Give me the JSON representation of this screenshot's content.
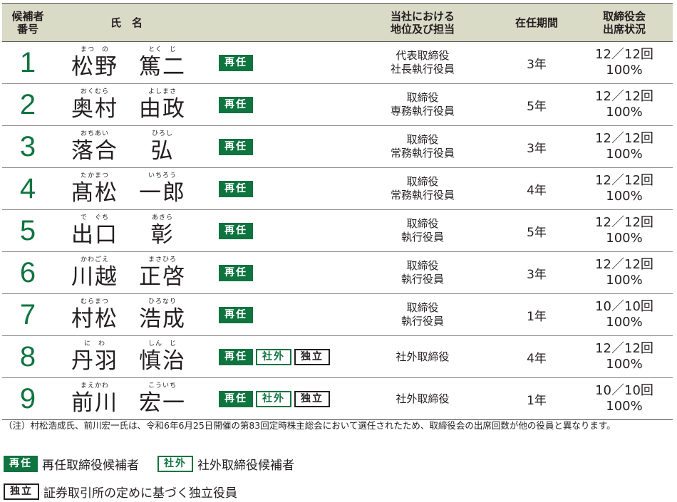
{
  "header": {
    "col_num": "候補者\n番号",
    "col_name": "氏　名",
    "col_position": "当社における\n地位及び担当",
    "col_term": "在任期間",
    "col_attendance": "取締役会\n出席状況"
  },
  "badges": {
    "reelection": "再任",
    "outside": "社外",
    "independent": "独立"
  },
  "candidates": [
    {
      "num": "1",
      "family": "松野",
      "family_ruby": "まつ　の",
      "given": "篤二",
      "given_ruby": "とく　じ",
      "position": "代表取締役\n社長執行役員",
      "term": "3年",
      "attendance": "12／12回",
      "rate": "100%",
      "outside": false,
      "independent": false
    },
    {
      "num": "2",
      "family": "奥村",
      "family_ruby": "おくむら",
      "given": "由政",
      "given_ruby": "よしまさ",
      "position": "取締役\n専務執行役員",
      "term": "5年",
      "attendance": "12／12回",
      "rate": "100%",
      "outside": false,
      "independent": false
    },
    {
      "num": "3",
      "family": "落合",
      "family_ruby": "おちあい",
      "given": "弘",
      "given_ruby": "ひろし",
      "position": "取締役\n常務執行役員",
      "term": "3年",
      "attendance": "12／12回",
      "rate": "100%",
      "outside": false,
      "independent": false
    },
    {
      "num": "4",
      "family": "髙松",
      "family_ruby": "たかまつ",
      "given": "一郎",
      "given_ruby": "いちろう",
      "position": "取締役\n常務執行役員",
      "term": "4年",
      "attendance": "12／12回",
      "rate": "100%",
      "outside": false,
      "independent": false
    },
    {
      "num": "5",
      "family": "出口",
      "family_ruby": "で　ぐち",
      "given": "彰",
      "given_ruby": "あきら",
      "position": "取締役\n執行役員",
      "term": "5年",
      "attendance": "12／12回",
      "rate": "100%",
      "outside": false,
      "independent": false
    },
    {
      "num": "6",
      "family": "川越",
      "family_ruby": "かわごえ",
      "given": "正啓",
      "given_ruby": "まさひろ",
      "position": "取締役\n執行役員",
      "term": "3年",
      "attendance": "12／12回",
      "rate": "100%",
      "outside": false,
      "independent": false
    },
    {
      "num": "7",
      "family": "村松",
      "family_ruby": "むらまつ",
      "given": "浩成",
      "given_ruby": "ひろなり",
      "position": "取締役\n執行役員",
      "term": "1年",
      "attendance": "10／10回",
      "rate": "100%",
      "outside": false,
      "independent": false
    },
    {
      "num": "8",
      "family": "丹羽",
      "family_ruby": "に　わ",
      "given": "慎治",
      "given_ruby": "しん　じ",
      "position": "社外取締役",
      "term": "4年",
      "attendance": "12／12回",
      "rate": "100%",
      "outside": true,
      "independent": true
    },
    {
      "num": "9",
      "family": "前川",
      "family_ruby": "まえかわ",
      "given": "宏一",
      "given_ruby": "こういち",
      "position": "社外取締役",
      "term": "1年",
      "attendance": "10／10回",
      "rate": "100%",
      "outside": true,
      "independent": true
    }
  ],
  "note": "（注）村松浩成氏、前川宏一氏は、令和6年6月25日開催の第83回定時株主総会において選任されたため、取締役会の出席回数が他の役員と異なります。",
  "legend": {
    "reelection_text": "再任取締役候補者",
    "outside_text": "社外取締役候補者",
    "independent_text": "証券取引所の定めに基づく独立役員"
  },
  "colors": {
    "accent_green": "#0f7440",
    "header_bg": "#d9dbc7"
  }
}
